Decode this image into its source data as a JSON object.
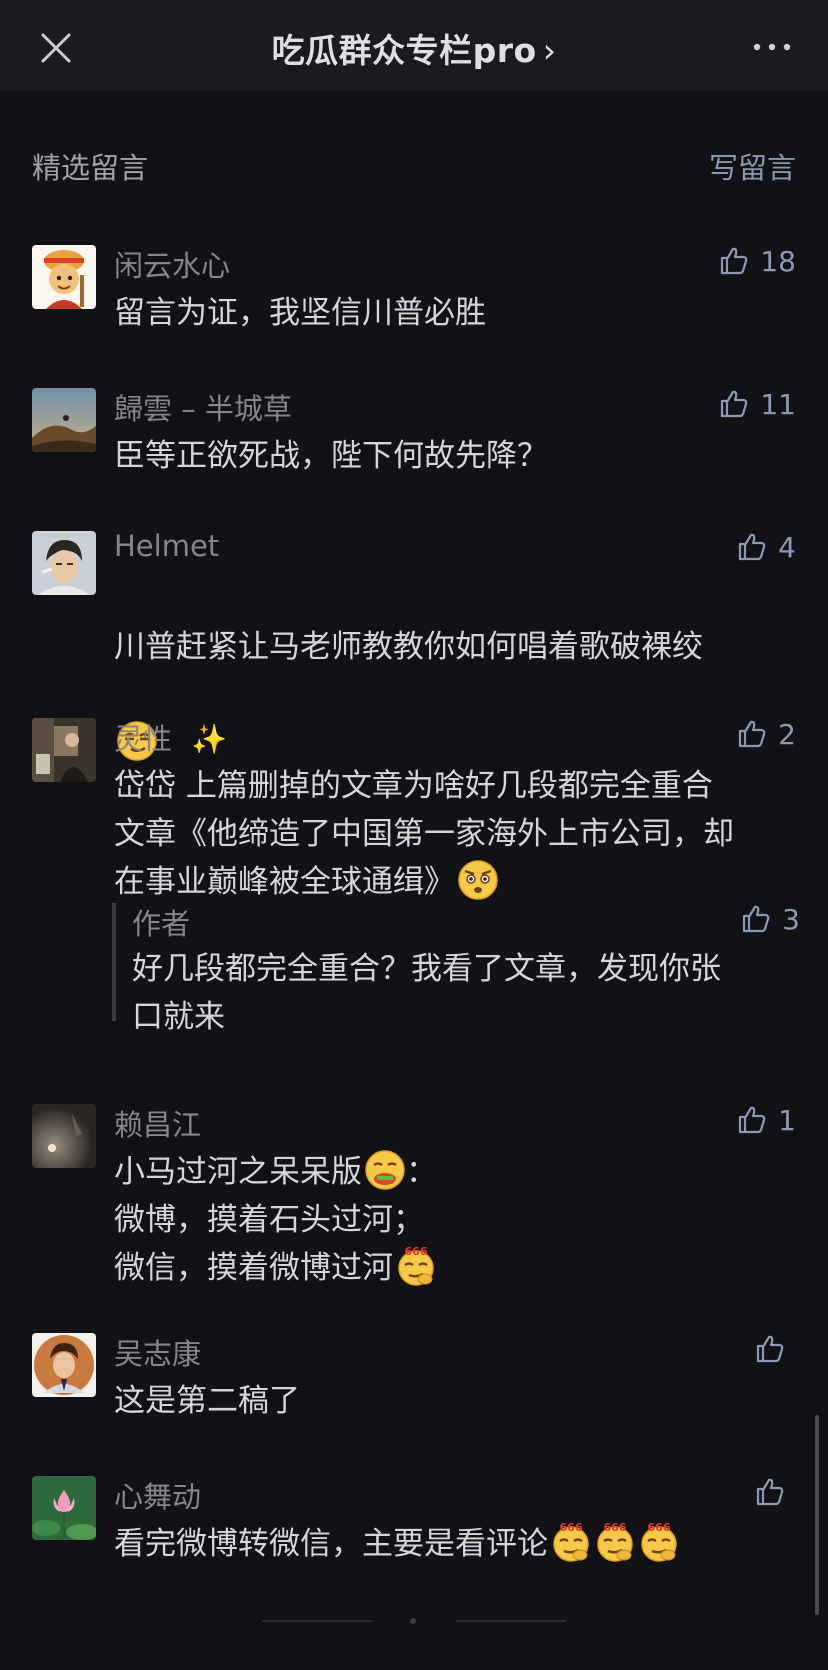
{
  "nav": {
    "title": "吃瓜群众专栏pro",
    "chevron": "›",
    "close_icon": "close-icon",
    "more_icon": "more-icon"
  },
  "section": {
    "label": "精选留言",
    "write": "写留言"
  },
  "comments": [
    {
      "author": "闲云水心",
      "likes": "18",
      "text": "留言为证，我坚信川普必胜"
    },
    {
      "author": "歸雲 – 半城草",
      "likes": "11",
      "text": "臣等正欲死战，陛下何故先降？"
    },
    {
      "author": "Helmet",
      "likes": "4",
      "text": "川普赶紧让马老师教教你如何唱着歌破裸绞"
    },
    {
      "author": "灵性",
      "author_suffix": "✨",
      "likes": "2",
      "text": "岱岱 上篇删掉的文章为啥好几段都完全重合\n文章《他缔造了中国第一家海外上市公司，却\n在事业巅峰被全球通缉》",
      "reply": {
        "author": "作者",
        "likes": "3",
        "text": "好几段都完全重合？我看了文章，发现你张\n口就来"
      }
    },
    {
      "author": "赖昌江",
      "likes": "1",
      "line1": "小马过河之呆呆版",
      "line1_end": "：",
      "line2": "微博，摸着石头过河；",
      "line3": "微信，摸着微博过河"
    },
    {
      "author": "吴志康",
      "likes": "",
      "text": "这是第二稿了"
    },
    {
      "author": "心舞动",
      "likes": "",
      "text": "看完微博转微信，主要是看评论"
    }
  ],
  "colors": {
    "background": "#121115",
    "nav_bg": "#1b1a1f",
    "accent": "#8a97b3",
    "author": "#85858a"
  }
}
